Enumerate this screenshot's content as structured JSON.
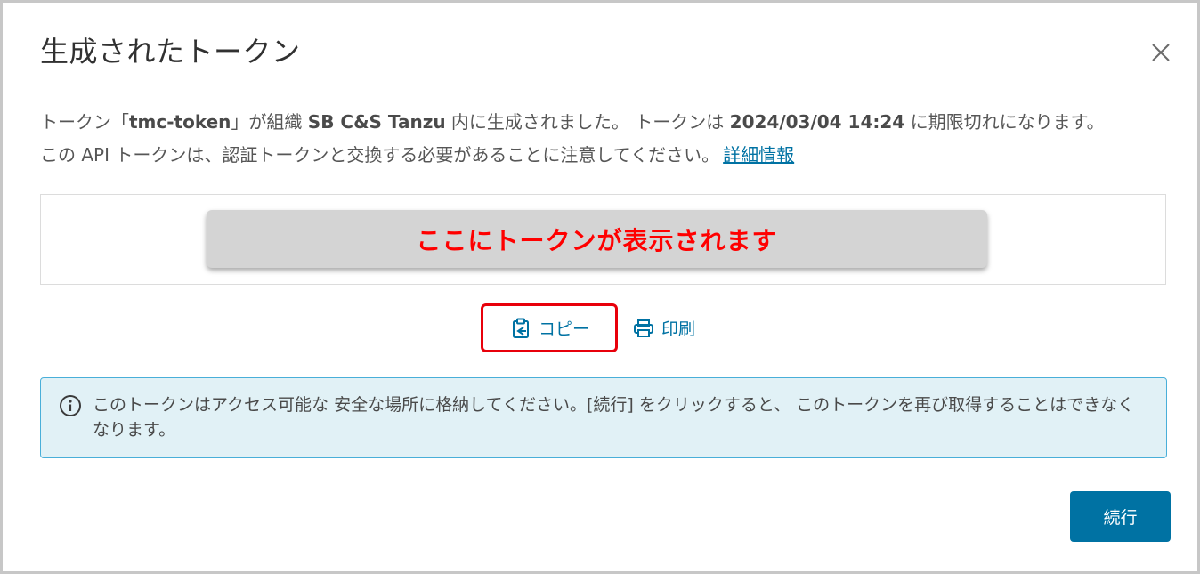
{
  "modal": {
    "title": "生成されたトークン"
  },
  "description": {
    "line1_pre": "トークン「",
    "token_name": "tmc-token",
    "line1_mid1": "」が組織 ",
    "org_name": "SB C&S Tanzu",
    "line1_mid2": " 内に生成されました。 トークンは ",
    "expiry": "2024/03/04 14:24",
    "line1_post": " に期限切れになります。",
    "line2": "この API トークンは、認証トークンと交換する必要があることに注意してください。",
    "link_label": "詳細情報"
  },
  "token": {
    "placeholder_text": "ここにトークンが表示されます"
  },
  "actions": {
    "copy_label": "コピー",
    "print_label": "印刷"
  },
  "alert": {
    "text": "このトークンはアクセス可能な 安全な場所に格納してください。[続行] をクリックすると、 このトークンを再び取得することはできなくなります。"
  },
  "footer": {
    "continue_label": "続行"
  },
  "colors": {
    "accent": "#0072a3",
    "alert_bg": "#e1f1f6",
    "alert_border": "#49afd9",
    "annotation_red": "#e8000b"
  },
  "icons": [
    "close-icon",
    "clipboard-icon",
    "printer-icon",
    "info-icon"
  ]
}
